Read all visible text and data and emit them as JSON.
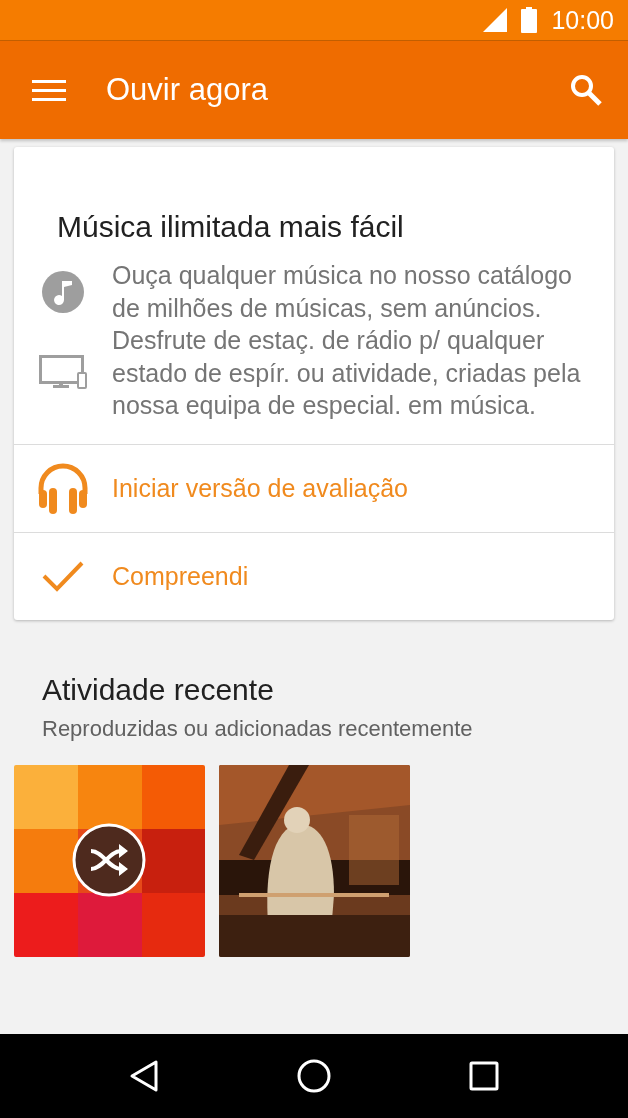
{
  "status_bar": {
    "time": "10:00"
  },
  "app_bar": {
    "title": "Ouvir agora"
  },
  "promo_card": {
    "title": "Música ilimitada mais fácil",
    "features": [
      {
        "kind": "music",
        "text": "Ouça qualquer música no nosso catálogo de milhões de músicas, sem anúncios."
      },
      {
        "kind": "devices",
        "text": "Desfrute de estaç. de rádio p/ qualquer estado de espír. ou atividade, criadas pela nossa equipa de especial. em música."
      }
    ],
    "actions": [
      {
        "kind": "headphones",
        "label": "Iniciar versão de avaliação"
      },
      {
        "kind": "check",
        "label": "Compreendi"
      }
    ]
  },
  "recent": {
    "title": "Atividade recente",
    "subtitle": "Reproduzidas ou adicionadas recentemente",
    "items": [
      {
        "kind": "shuffle"
      },
      {
        "kind": "picture"
      }
    ]
  }
}
